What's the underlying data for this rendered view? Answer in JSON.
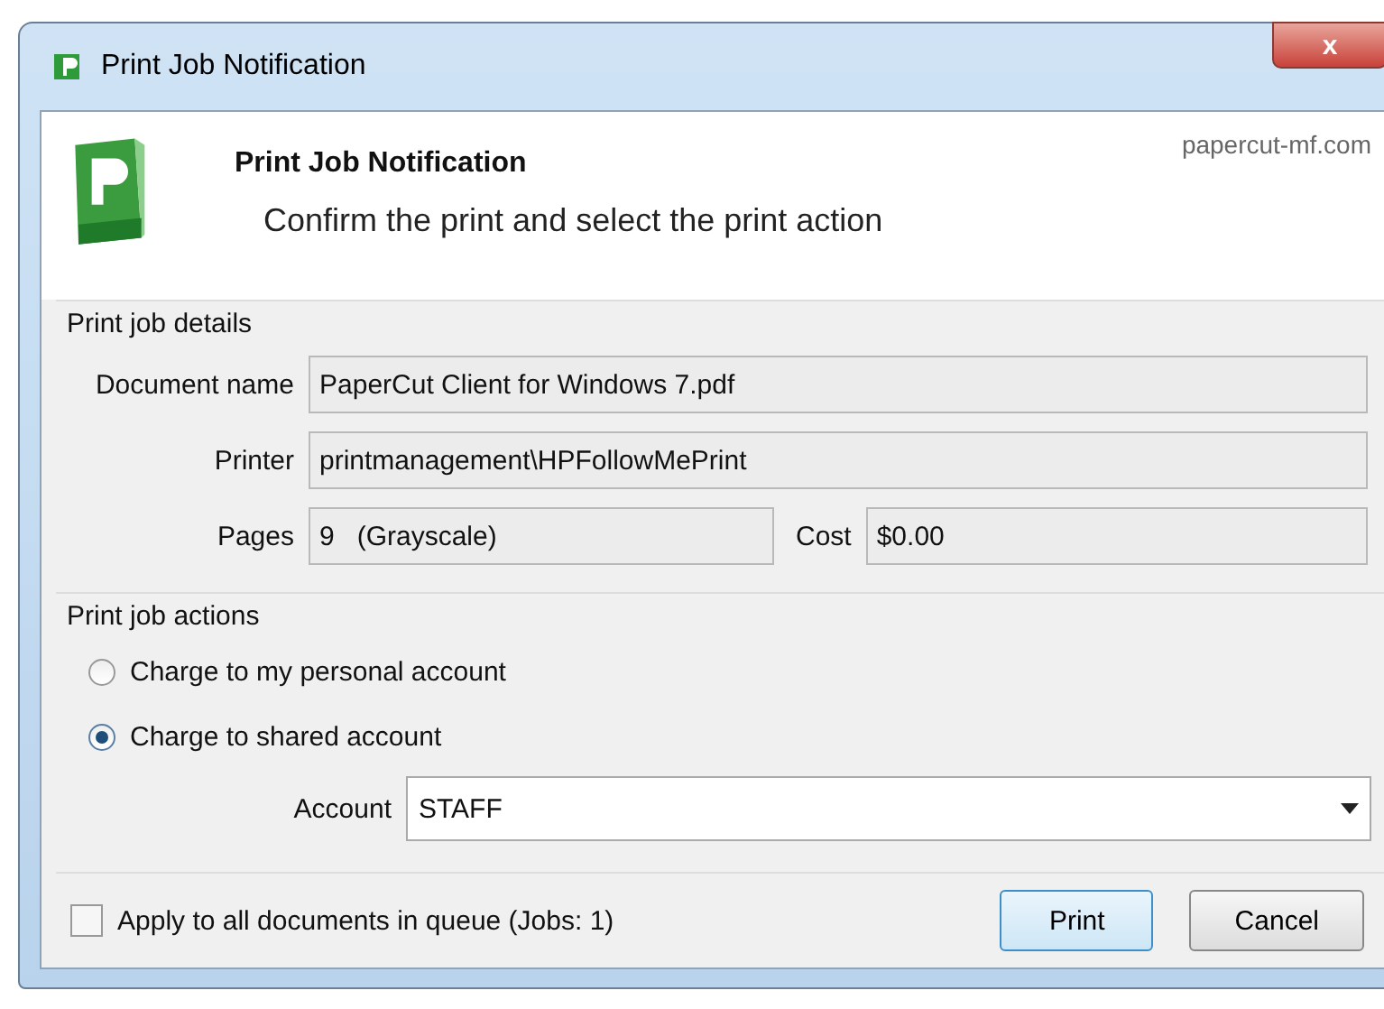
{
  "window": {
    "title": "Print Job Notification",
    "close": "x"
  },
  "header": {
    "title": "Print Job Notification",
    "subtitle": "Confirm the print and select the print action",
    "site": "papercut-mf.com"
  },
  "details": {
    "title": "Print job details",
    "document_label": "Document name",
    "document": "PaperCut Client for Windows 7.pdf",
    "printer_label": "Printer",
    "printer": "printmanagement\\HPFollowMePrint",
    "pages_label": "Pages",
    "pages": "9   (Grayscale)",
    "cost_label": "Cost",
    "cost": "$0.00"
  },
  "actions": {
    "title": "Print job actions",
    "options": [
      {
        "label": "Charge to my personal account",
        "selected": false
      },
      {
        "label": "Charge to shared account",
        "selected": true
      }
    ],
    "account_label": "Account",
    "account": "STAFF"
  },
  "apply_all": {
    "label": "Apply to all documents in queue (Jobs: 1)",
    "checked": false
  },
  "buttons": [
    {
      "label": "Print",
      "default": true
    },
    {
      "label": "Cancel",
      "default": false
    }
  ]
}
